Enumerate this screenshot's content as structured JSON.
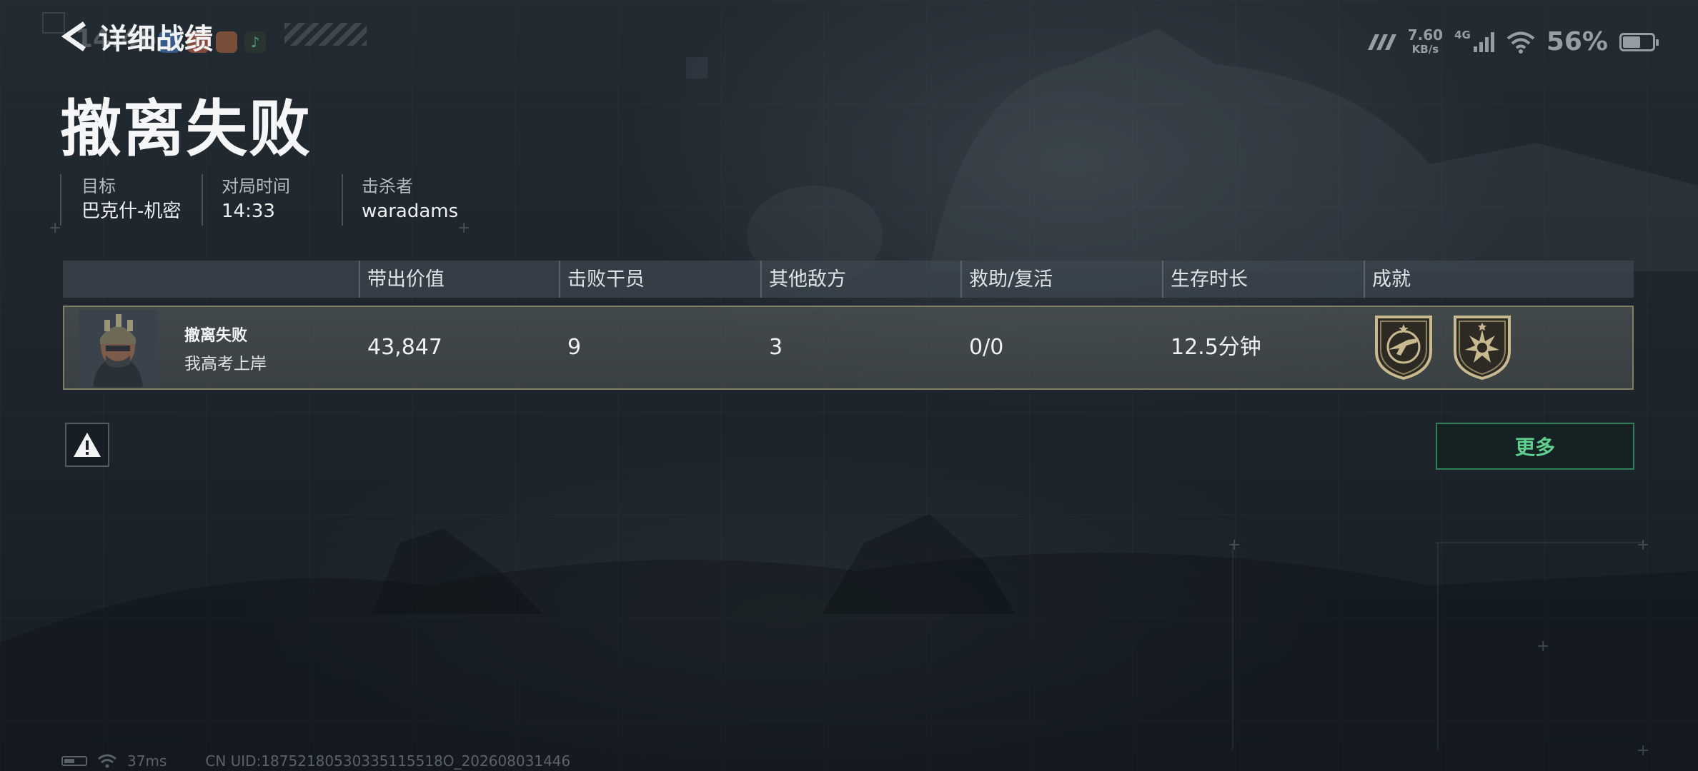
{
  "status_bar": {
    "time": "14:46",
    "net_speed": "7.60",
    "net_speed_unit": "KB/s",
    "network_label": "4G",
    "battery_percent": "56%",
    "battery_level": 0.56
  },
  "header": {
    "back_title": "详细战绩",
    "result_title": "撤离失败"
  },
  "info": [
    {
      "label": "目标",
      "value": "巴克什-机密"
    },
    {
      "label": "对局时间",
      "value": "14:33"
    },
    {
      "label": "击杀者",
      "value": "waradams"
    }
  ],
  "table": {
    "headers": [
      "带出价值",
      "击败干员",
      "其他敌方",
      "救助/复活",
      "生存时长",
      "成就"
    ],
    "player": {
      "status": "撤离失败",
      "name": "我高考上岸",
      "value_out": "43,847",
      "operators_defeated": "9",
      "other_enemies": "3",
      "assists_revives": "0/0",
      "survival_time": "12.5分钟",
      "achievement_icons": [
        "achievement-rifle-badge-icon",
        "achievement-burst-badge-icon"
      ]
    }
  },
  "buttons": {
    "more": "更多"
  },
  "footer": {
    "ping": "37ms",
    "uid": "CN UID:18752180530335115518O_202608031446"
  },
  "colors": {
    "accent_green": "#5fd08e",
    "row_border": "#96926e",
    "badge_gold": "#c9b98e"
  }
}
